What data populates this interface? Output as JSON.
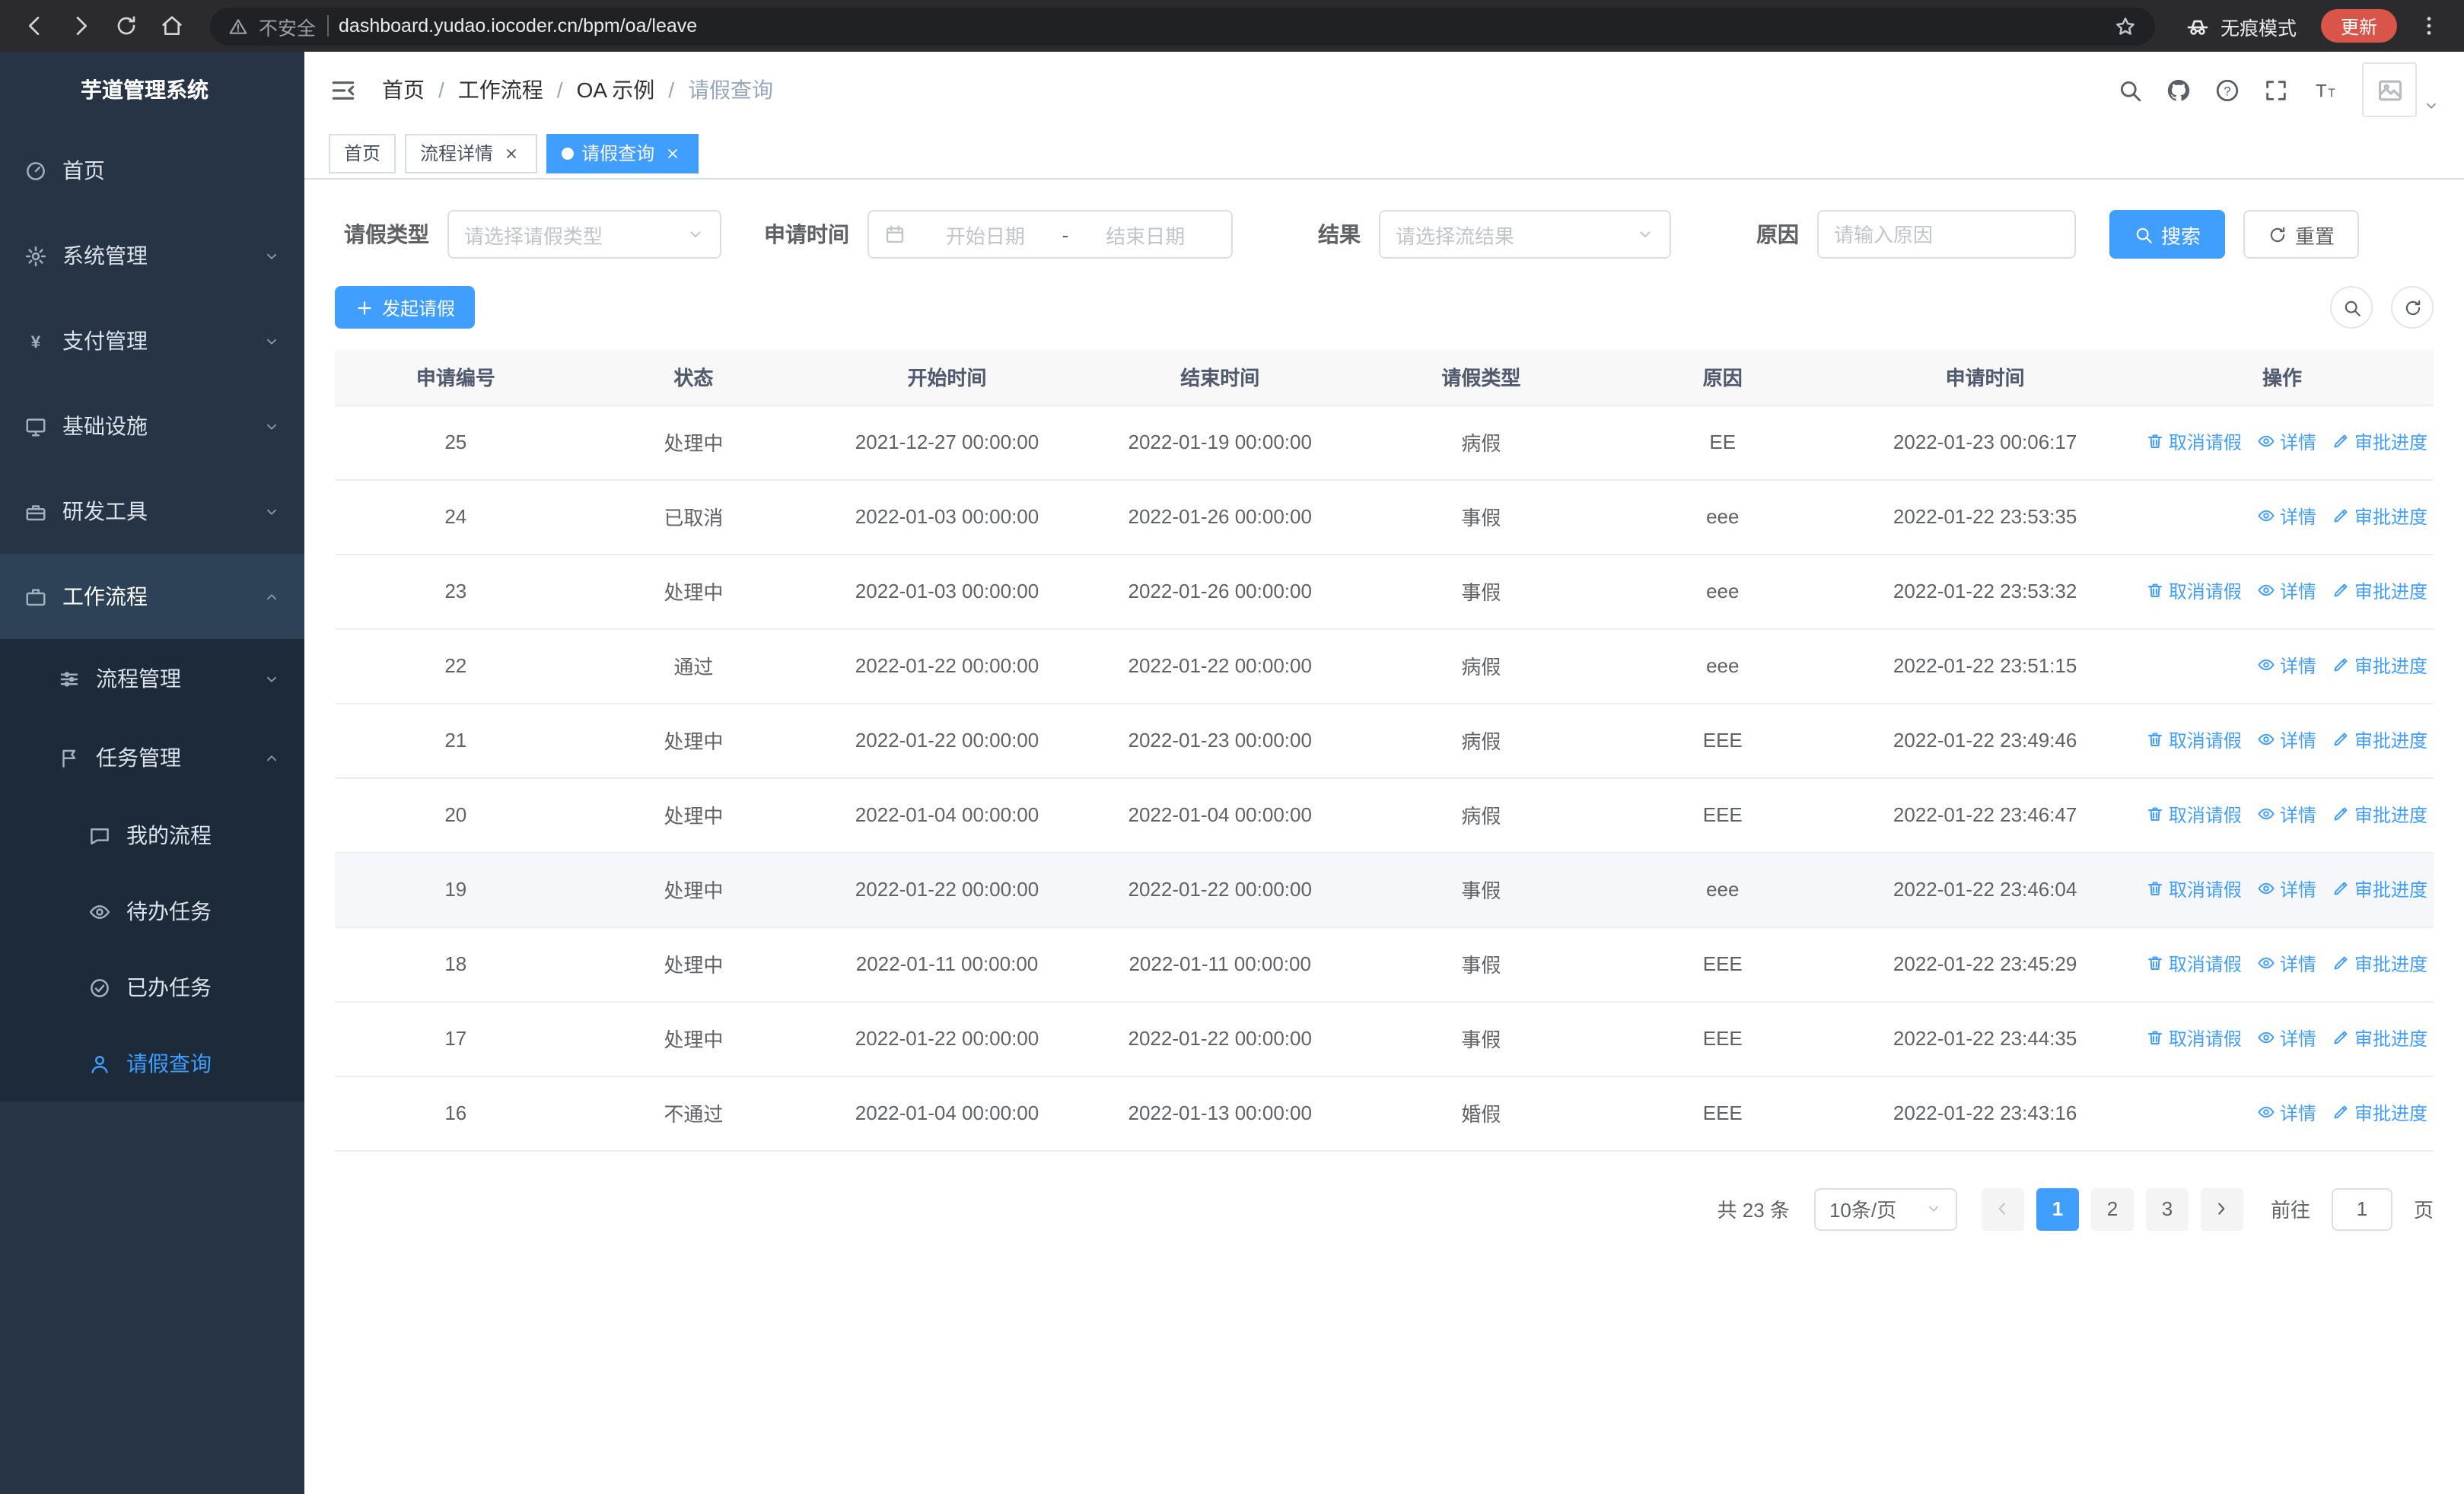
{
  "theme": {
    "primary": "#409eff",
    "sidebar_bg": "#273445",
    "submenu_bg": "#1d2a39",
    "browser_bar_bg": "#2b2b2e",
    "update_button_bg": "#d9554a"
  },
  "browser": {
    "security_label": "不安全",
    "url": "dashboard.yudao.iocoder.cn/bpm/oa/leave",
    "incognito_label": "无痕模式",
    "update_label": "更新"
  },
  "sidebar": {
    "title": "芋道管理系统",
    "items": [
      {
        "label": "首页",
        "icon": "dashboard-icon",
        "level": 1
      },
      {
        "label": "系统管理",
        "icon": "gear-icon",
        "level": 1,
        "chevron": "down"
      },
      {
        "label": "支付管理",
        "icon": "yen-icon",
        "level": 1,
        "chevron": "down"
      },
      {
        "label": "基础设施",
        "icon": "monitor-icon",
        "level": 1,
        "chevron": "down"
      },
      {
        "label": "研发工具",
        "icon": "toolbox-icon",
        "level": 1,
        "chevron": "down"
      },
      {
        "label": "工作流程",
        "icon": "briefcase-icon",
        "level": 1,
        "chevron": "up",
        "open": true
      },
      {
        "label": "流程管理",
        "icon": "sliders-icon",
        "level": 2,
        "chevron": "down"
      },
      {
        "label": "任务管理",
        "icon": "flag-icon",
        "level": 2,
        "chevron": "up"
      },
      {
        "label": "我的流程",
        "icon": "chat-icon",
        "level": 3
      },
      {
        "label": "待办任务",
        "icon": "eye-icon",
        "level": 3
      },
      {
        "label": "已办任务",
        "icon": "done-icon",
        "level": 3
      },
      {
        "label": "请假查询",
        "icon": "user-icon",
        "level": 3,
        "active": true
      }
    ]
  },
  "topbar": {
    "breadcrumbs": [
      {
        "label": "首页"
      },
      {
        "label": "工作流程"
      },
      {
        "label": "OA 示例"
      },
      {
        "label": "请假查询",
        "muted": true
      }
    ],
    "separator": "/",
    "action_icons": [
      "search-icon",
      "github-icon",
      "question-icon",
      "fullscreen-icon",
      "fontsize-icon"
    ]
  },
  "tabs": [
    {
      "label": "首页"
    },
    {
      "label": "流程详情",
      "closable": true
    },
    {
      "label": "请假查询",
      "closable": true,
      "active": true
    }
  ],
  "filters": {
    "leave_type_label": "请假类型",
    "leave_type_placeholder": "请选择请假类型",
    "apply_time_label": "申请时间",
    "date_start_placeholder": "开始日期",
    "date_separator": "-",
    "date_end_placeholder": "结束日期",
    "result_label": "结果",
    "result_placeholder": "请选择流结果",
    "reason_label": "原因",
    "reason_placeholder": "请输入原因",
    "search_label": "搜索",
    "reset_label": "重置"
  },
  "toolbar": {
    "create_label": "发起请假"
  },
  "table": {
    "columns": [
      "申请编号",
      "状态",
      "开始时间",
      "结束时间",
      "请假类型",
      "原因",
      "申请时间",
      "操作"
    ],
    "action_defs": {
      "cancel": {
        "label": "取消请假",
        "icon": "delete-icon"
      },
      "detail": {
        "label": "详情",
        "icon": "view-icon"
      },
      "progress": {
        "label": "审批进度",
        "icon": "edit-icon"
      }
    },
    "rows": [
      {
        "id": "25",
        "status": "处理中",
        "start": "2021-12-27 00:00:00",
        "end": "2022-01-19 00:00:00",
        "type": "病假",
        "reason": "EE",
        "applied": "2022-01-23 00:06:17",
        "actions": [
          "cancel",
          "detail",
          "progress"
        ]
      },
      {
        "id": "24",
        "status": "已取消",
        "start": "2022-01-03 00:00:00",
        "end": "2022-01-26 00:00:00",
        "type": "事假",
        "reason": "eee",
        "applied": "2022-01-22 23:53:35",
        "actions": [
          "detail",
          "progress"
        ]
      },
      {
        "id": "23",
        "status": "处理中",
        "start": "2022-01-03 00:00:00",
        "end": "2022-01-26 00:00:00",
        "type": "事假",
        "reason": "eee",
        "applied": "2022-01-22 23:53:32",
        "actions": [
          "cancel",
          "detail",
          "progress"
        ]
      },
      {
        "id": "22",
        "status": "通过",
        "start": "2022-01-22 00:00:00",
        "end": "2022-01-22 00:00:00",
        "type": "病假",
        "reason": "eee",
        "applied": "2022-01-22 23:51:15",
        "actions": [
          "detail",
          "progress"
        ]
      },
      {
        "id": "21",
        "status": "处理中",
        "start": "2022-01-22 00:00:00",
        "end": "2022-01-23 00:00:00",
        "type": "病假",
        "reason": "EEE",
        "applied": "2022-01-22 23:49:46",
        "actions": [
          "cancel",
          "detail",
          "progress"
        ]
      },
      {
        "id": "20",
        "status": "处理中",
        "start": "2022-01-04 00:00:00",
        "end": "2022-01-04 00:00:00",
        "type": "病假",
        "reason": "EEE",
        "applied": "2022-01-22 23:46:47",
        "actions": [
          "cancel",
          "detail",
          "progress"
        ]
      },
      {
        "id": "19",
        "status": "处理中",
        "start": "2022-01-22 00:00:00",
        "end": "2022-01-22 00:00:00",
        "type": "事假",
        "reason": "eee",
        "applied": "2022-01-22 23:46:04",
        "actions": [
          "cancel",
          "detail",
          "progress"
        ],
        "highlight": true
      },
      {
        "id": "18",
        "status": "处理中",
        "start": "2022-01-11 00:00:00",
        "end": "2022-01-11 00:00:00",
        "type": "事假",
        "reason": "EEE",
        "applied": "2022-01-22 23:45:29",
        "actions": [
          "cancel",
          "detail",
          "progress"
        ]
      },
      {
        "id": "17",
        "status": "处理中",
        "start": "2022-01-22 00:00:00",
        "end": "2022-01-22 00:00:00",
        "type": "事假",
        "reason": "EEE",
        "applied": "2022-01-22 23:44:35",
        "actions": [
          "cancel",
          "detail",
          "progress"
        ]
      },
      {
        "id": "16",
        "status": "不通过",
        "start": "2022-01-04 00:00:00",
        "end": "2022-01-13 00:00:00",
        "type": "婚假",
        "reason": "EEE",
        "applied": "2022-01-22 23:43:16",
        "actions": [
          "detail",
          "progress"
        ]
      }
    ]
  },
  "pagination": {
    "total_label": "共 23 条",
    "page_size_label": "10条/页",
    "pages": [
      "1",
      "2",
      "3"
    ],
    "active_page": "1",
    "goto_label": "前往",
    "goto_value": "1",
    "goto_unit_label": "页"
  }
}
